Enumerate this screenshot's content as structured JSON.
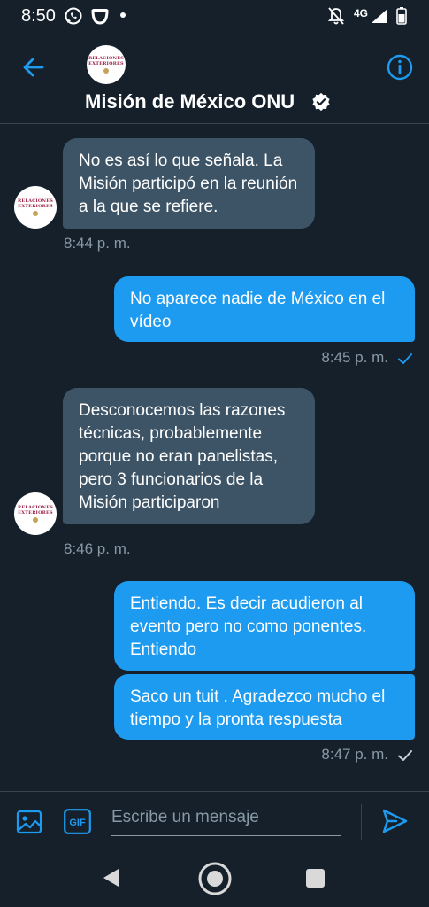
{
  "status_bar": {
    "time": "8:50",
    "network": "4G"
  },
  "header": {
    "title": "Misión de México ONU",
    "avatar_text": [
      "RELACIONES",
      "EXTERIORES"
    ]
  },
  "messages": [
    {
      "direction": "in",
      "text": "No es así lo que señala. La Misión participó en la reunión a la que se refiere.",
      "time": "8:44 p. m."
    },
    {
      "direction": "out",
      "text": "No aparece nadie de México en el vídeo",
      "time": "8:45 p. m.",
      "status": "sent"
    },
    {
      "direction": "in",
      "text": "Desconocemos las razones técnicas, probablemente porque no eran panelistas, pero 3 funcionarios de la Misión participaron",
      "time": "8:46 p. m."
    },
    {
      "direction": "out",
      "text": "Entiendo. Es decir acudieron al evento pero no como ponentes. Entiendo"
    },
    {
      "direction": "out",
      "text": "Saco un tuit . Agradezco mucho el tiempo y la pronta respuesta",
      "time": "8:47 p. m.",
      "status": "read"
    }
  ],
  "composer": {
    "placeholder": "Escribe un mensaje",
    "gif_label": "GIF"
  },
  "colors": {
    "background": "#15202b",
    "accent": "#1d9bf0",
    "incoming_bubble": "#3d5466",
    "muted": "#8899a6"
  }
}
